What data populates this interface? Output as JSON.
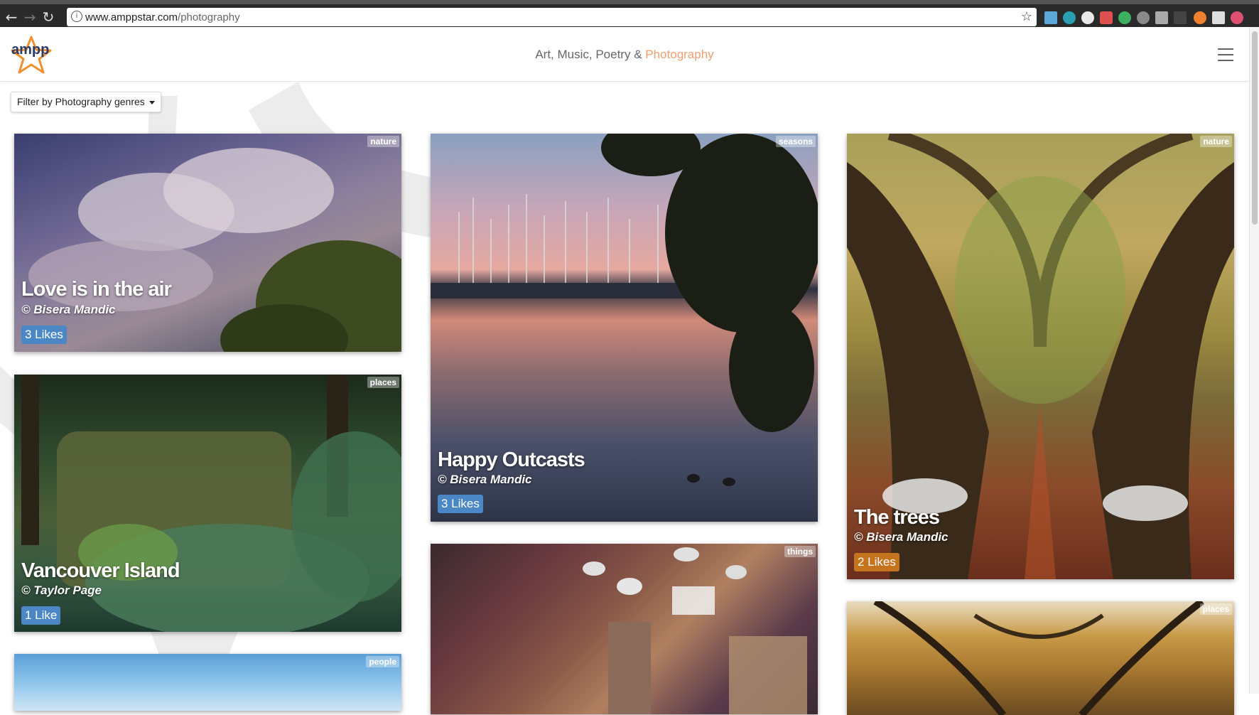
{
  "browser": {
    "url_host": "www.amppstar.com",
    "url_path": "/photography"
  },
  "header": {
    "logo_text": "ampp",
    "tagline_prefix": "Art, Music, Poetry & ",
    "tagline_accent": "Photography"
  },
  "filter": {
    "label": "Filter by Photography genres"
  },
  "cards": [
    {
      "genre": "nature",
      "title": "Love is in the air",
      "author": "© Bisera Mandic",
      "likes": "3 Likes"
    },
    {
      "genre": "places",
      "title": "Vancouver Island",
      "author": "© Taylor Page",
      "likes": "1 Like"
    },
    {
      "genre": "people",
      "title": "",
      "author": "",
      "likes": ""
    },
    {
      "genre": "seasons",
      "title": "Happy Outcasts",
      "author": "© Bisera Mandic",
      "likes": "3 Likes"
    },
    {
      "genre": "things",
      "title": "",
      "author": "",
      "likes": ""
    },
    {
      "genre": "nature",
      "title": "The trees",
      "author": "© Bisera Mandic",
      "likes": "2 Likes"
    },
    {
      "genre": "places",
      "title": "",
      "author": "",
      "likes": ""
    }
  ],
  "colors": {
    "accent": "#f0a070",
    "likes_blue": "#4a87c4",
    "likes_orange": "#c6731e"
  }
}
